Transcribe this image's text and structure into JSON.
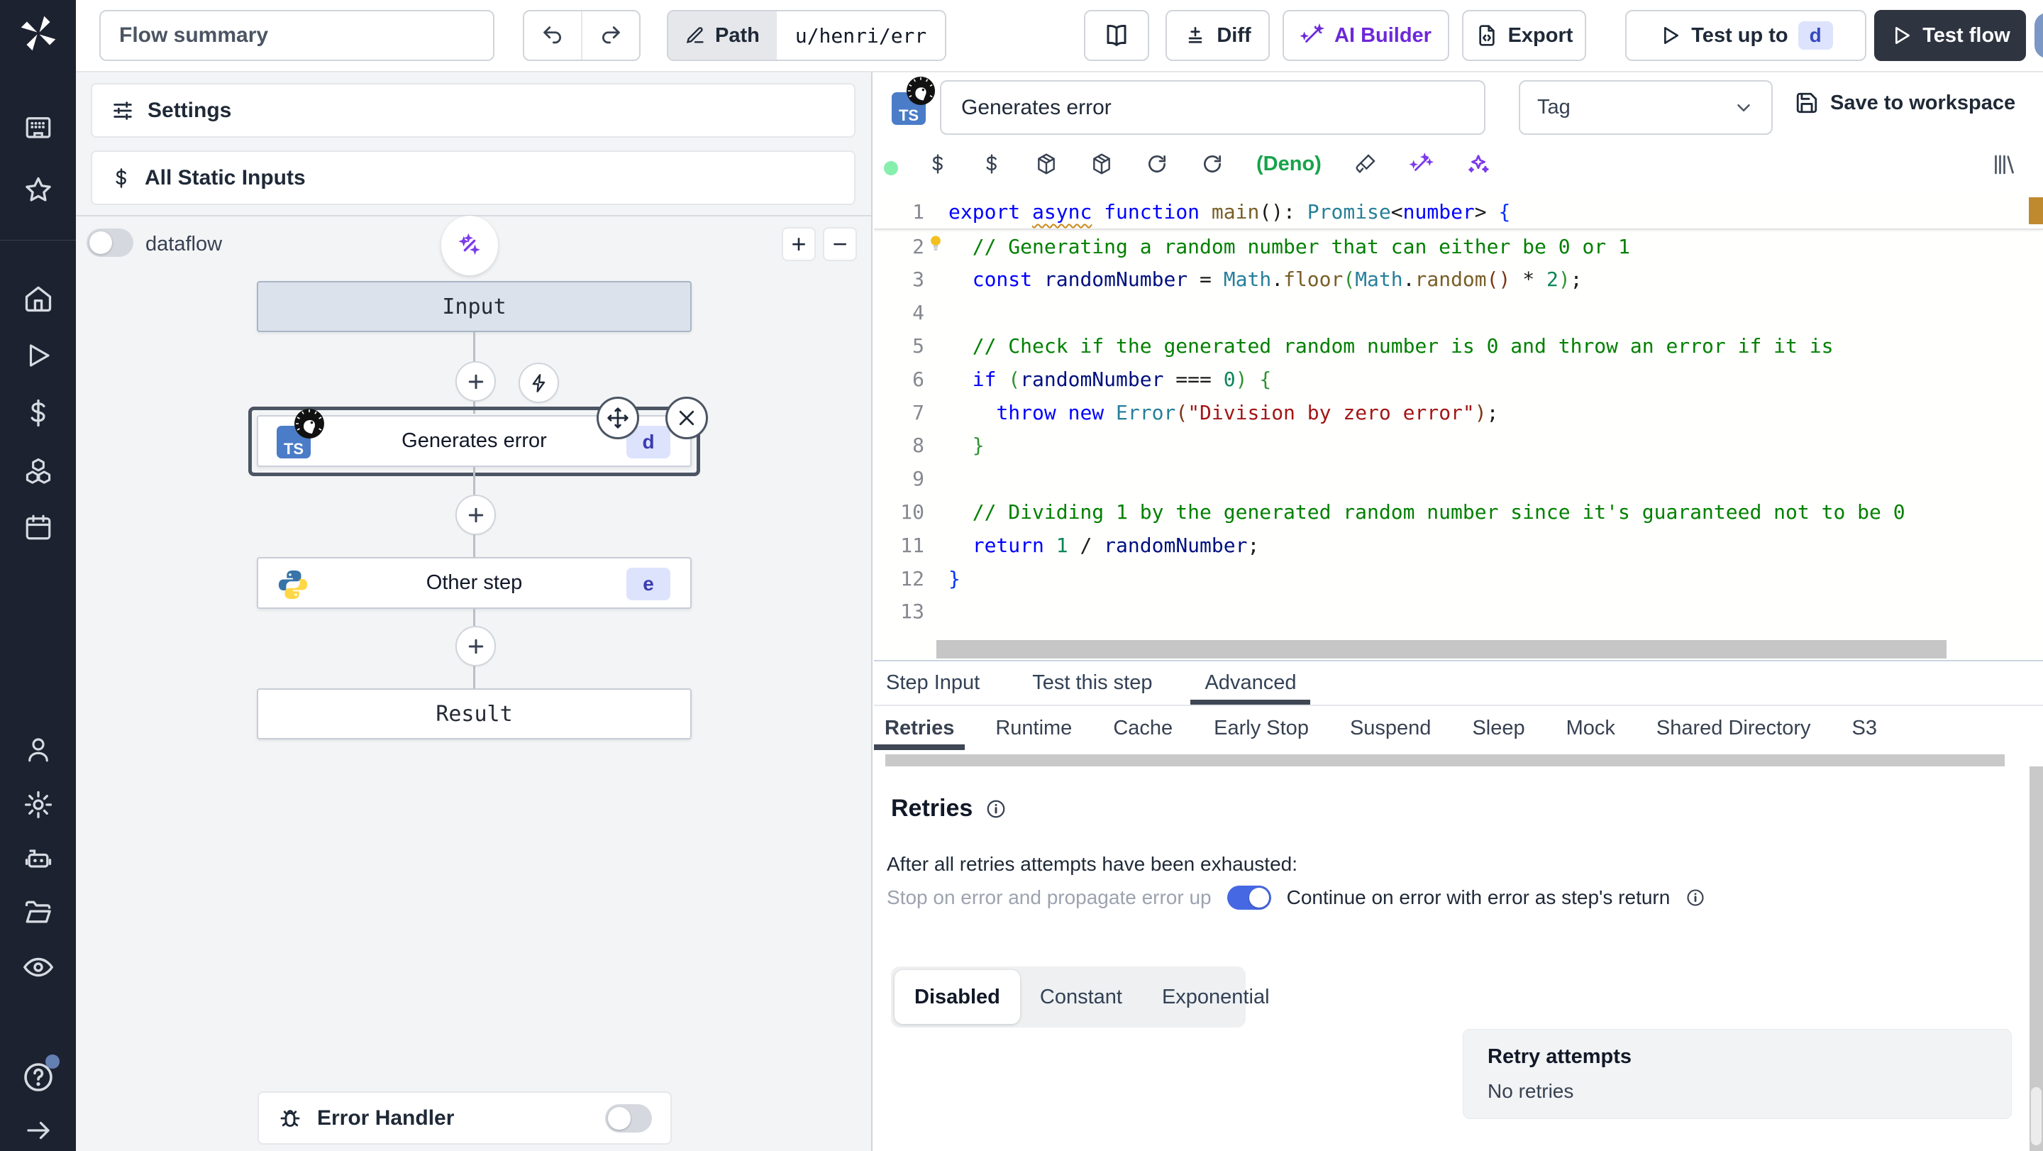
{
  "topbar": {
    "flow_summary": "Flow summary",
    "path_label": "Path",
    "path_value": "u/henri/err",
    "diff_label": "Diff",
    "ai_builder_label": "AI Builder",
    "export_label": "Export",
    "test_up_to_label": "Test up to",
    "test_up_to_badge": "d",
    "test_flow_label": "Test flow"
  },
  "sidebar": {
    "icon_names": [
      "windmill-logo",
      "workspace-building",
      "favorites-star",
      "home",
      "runs-play",
      "variables-dollar",
      "resources-cubes",
      "schedules-calendar",
      "user",
      "settings-gear",
      "workers-robot",
      "folders",
      "audit-eye",
      "help-question",
      "collapse-arrow-right"
    ]
  },
  "flow_panel": {
    "settings_label": "Settings",
    "static_inputs_label": "All Static Inputs",
    "dataflow_label": "dataflow",
    "zoom_in_label": "+",
    "zoom_out_label": "−",
    "input_node_label": "Input",
    "result_node_label": "Result",
    "step1_title": "Generates error",
    "step1_badge": "d",
    "step1_lang": "TS",
    "step2_title": "Other step",
    "step2_badge": "e",
    "error_handler_label": "Error Handler"
  },
  "right_panel": {
    "step_name": "Generates error",
    "step_lang": "TS",
    "tag_placeholder": "Tag",
    "save_label": "Save to workspace",
    "deno_indicator": "(Deno)",
    "tabs": [
      "Step Input",
      "Test this step",
      "Advanced"
    ],
    "active_tab": 2,
    "subtabs": [
      "Retries",
      "Runtime",
      "Cache",
      "Early Stop",
      "Suspend",
      "Sleep",
      "Mock",
      "Shared Directory",
      "S3"
    ],
    "active_subtab": 0,
    "retries": {
      "heading": "Retries",
      "exhausted_text": "After all retries attempts have been exhausted:",
      "toggle_left_label": "Stop on error and propagate error up",
      "toggle_right_label": "Continue on error with error as step's return",
      "modes": [
        "Disabled",
        "Constant",
        "Exponential"
      ],
      "active_mode": 0,
      "retry_attempts_label": "Retry attempts",
      "retry_attempts_value": "No retries"
    }
  },
  "code": {
    "lines": [
      [
        [
          "kw",
          "export "
        ],
        [
          "kwsq",
          "async"
        ],
        [
          "p",
          " "
        ],
        [
          "kw",
          "function"
        ],
        [
          "p",
          " "
        ],
        [
          "fn",
          "main"
        ],
        [
          "p",
          "(): "
        ],
        [
          "typ",
          "Promise"
        ],
        [
          "p",
          "<"
        ],
        [
          "kw",
          "number"
        ],
        [
          "p",
          "> "
        ],
        [
          "b1",
          "{"
        ]
      ],
      [
        [
          "p",
          "  "
        ],
        [
          "cmt",
          "// Generating a random number that can either be 0 or 1"
        ]
      ],
      [
        [
          "p",
          "  "
        ],
        [
          "kw",
          "const"
        ],
        [
          "p",
          " "
        ],
        [
          "var",
          "randomNumber"
        ],
        [
          "p",
          " = "
        ],
        [
          "typ",
          "Math"
        ],
        [
          "p",
          "."
        ],
        [
          "fn",
          "floor"
        ],
        [
          "b2",
          "("
        ],
        [
          "typ",
          "Math"
        ],
        [
          "p",
          "."
        ],
        [
          "fn",
          "random"
        ],
        [
          "b3",
          "()"
        ],
        [
          "p",
          " * "
        ],
        [
          "num",
          "2"
        ],
        [
          "b2",
          ")"
        ],
        [
          "p",
          ";"
        ]
      ],
      [],
      [
        [
          "p",
          "  "
        ],
        [
          "cmt",
          "// Check if the generated random number is 0 and throw an error if it is"
        ]
      ],
      [
        [
          "p",
          "  "
        ],
        [
          "kw",
          "if"
        ],
        [
          "p",
          " "
        ],
        [
          "b2",
          "("
        ],
        [
          "var",
          "randomNumber"
        ],
        [
          "p",
          " === "
        ],
        [
          "num",
          "0"
        ],
        [
          "b2",
          ")"
        ],
        [
          "p",
          " "
        ],
        [
          "b2",
          "{"
        ]
      ],
      [
        [
          "p",
          "    "
        ],
        [
          "kw",
          "throw"
        ],
        [
          "p",
          " "
        ],
        [
          "kw",
          "new"
        ],
        [
          "p",
          " "
        ],
        [
          "typ",
          "Error"
        ],
        [
          "b3",
          "("
        ],
        [
          "str",
          "\"Division by zero error\""
        ],
        [
          "b3",
          ")"
        ],
        [
          "p",
          ";"
        ]
      ],
      [
        [
          "p",
          "  "
        ],
        [
          "b2",
          "}"
        ]
      ],
      [],
      [
        [
          "p",
          "  "
        ],
        [
          "cmt",
          "// Dividing 1 by the generated random number since it's guaranteed not to be 0"
        ]
      ],
      [
        [
          "p",
          "  "
        ],
        [
          "kw",
          "return"
        ],
        [
          "p",
          " "
        ],
        [
          "num",
          "1"
        ],
        [
          "p",
          " / "
        ],
        [
          "var",
          "randomNumber"
        ],
        [
          "p",
          ";"
        ]
      ],
      [
        [
          "b1",
          "}"
        ]
      ],
      []
    ]
  },
  "colors": {
    "accent_purple": "#6d28d9",
    "deno_green": "#16a34a",
    "status_green_dot": "#86efac",
    "toggle_blue": "#4668e3",
    "badge_bg": "#dde3fc",
    "badge_text": "#3749c0",
    "dark_button": "#2e3440",
    "selection_ring": "#4b5563",
    "input_node_bg": "#dbe2ec",
    "warning_marker": "#bf8a2e"
  }
}
